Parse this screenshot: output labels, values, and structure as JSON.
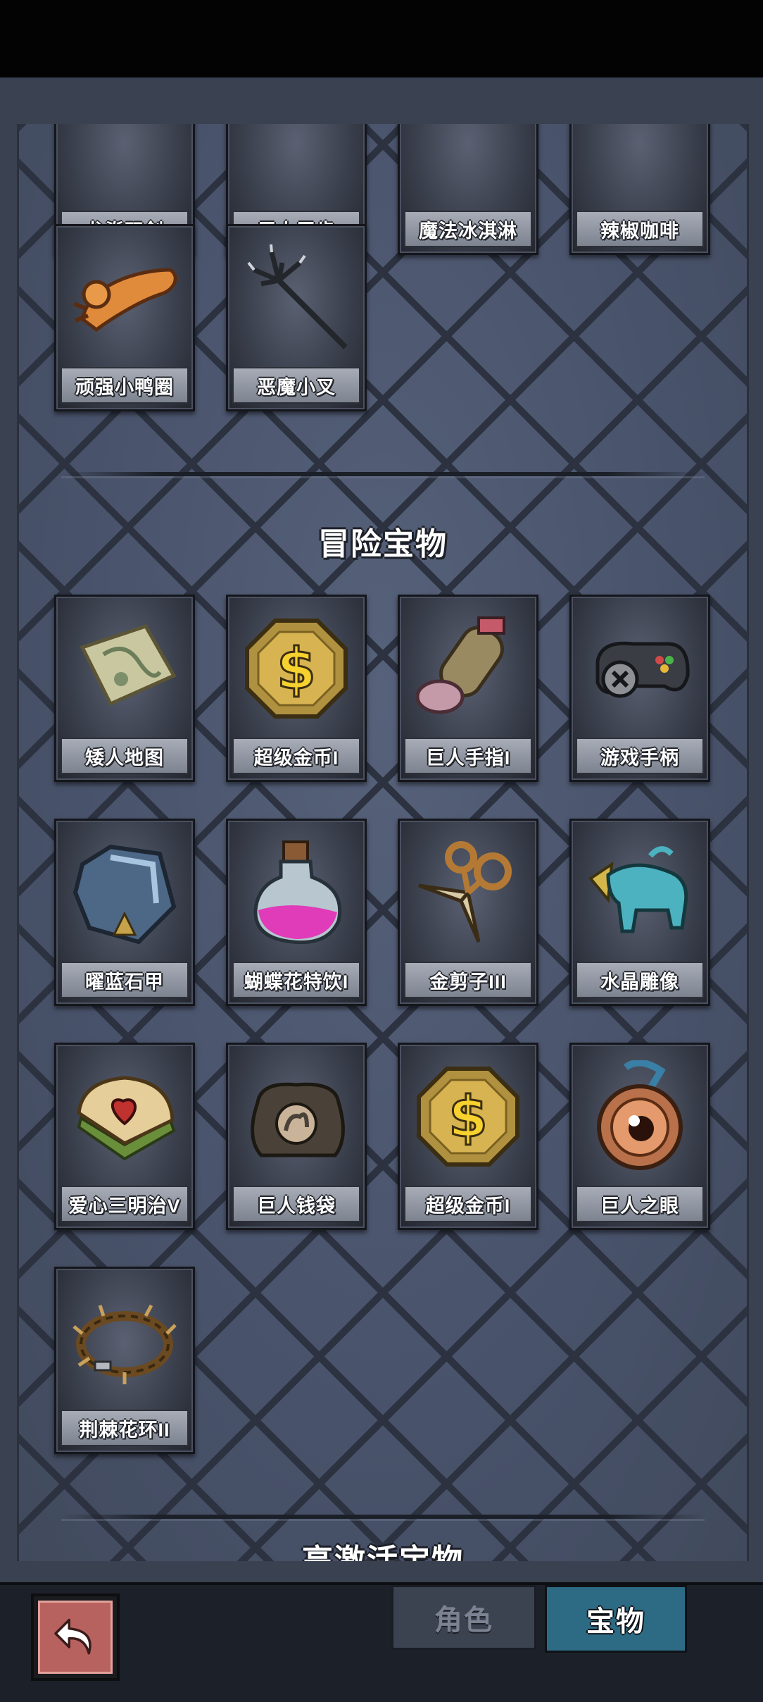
{
  "prev_section": {
    "row1": [
      "龙脊双剑",
      "巨人牙齿",
      "魔法冰淇淋",
      "辣椒咖啡"
    ],
    "row2": [
      "顽强小鸭圈",
      "恶魔小叉"
    ]
  },
  "adventure_section": {
    "title": "冒险宝物",
    "items": [
      "矮人地图",
      "超级金币I",
      "巨人手指I",
      "游戏手柄",
      "曜蓝石甲",
      "蝴蝶花特饮I",
      "金剪子III",
      "水晶雕像",
      "爱心三明治V",
      "巨人钱袋",
      "超级金币I",
      "巨人之眼",
      "荆棘花环II"
    ]
  },
  "next_section": {
    "title_partial": "高激活宝物"
  },
  "bottom_bar": {
    "back_icon": "back-arrow-icon",
    "tab_role": "角色",
    "tab_treasure": "宝物",
    "active_tab": "宝物"
  },
  "colors": {
    "panel_bg": "#4b5568",
    "active_tab": "#2d6b85",
    "back_button": "#b8625f"
  }
}
